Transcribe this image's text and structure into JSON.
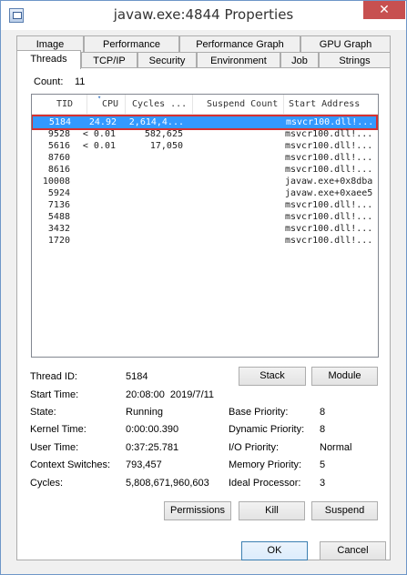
{
  "window": {
    "title": "javaw.exe:4844 Properties",
    "close_glyph": "✕"
  },
  "tabs_row1": [
    "Image",
    "Performance",
    "Performance Graph",
    "GPU Graph"
  ],
  "tabs_row2": [
    "Threads",
    "TCP/IP",
    "Security",
    "Environment",
    "Job",
    "Strings"
  ],
  "active_tab": "Threads",
  "count": {
    "label": "Count:",
    "value": "11"
  },
  "columns": [
    "TID",
    "CPU",
    "Cycles ...",
    "Suspend Count",
    "Start Address"
  ],
  "threads": [
    {
      "tid": "5184",
      "cpu": "24.92",
      "cycles": "2,614,4...",
      "address": "msvcr100.dll!...",
      "selected": true
    },
    {
      "tid": "9528",
      "cpu": "< 0.01",
      "cycles": "582,625",
      "address": "msvcr100.dll!..."
    },
    {
      "tid": "5616",
      "cpu": "< 0.01",
      "cycles": "17,050",
      "address": "msvcr100.dll!..."
    },
    {
      "tid": "8760",
      "cpu": "",
      "cycles": "",
      "address": "msvcr100.dll!..."
    },
    {
      "tid": "8616",
      "cpu": "",
      "cycles": "",
      "address": "msvcr100.dll!..."
    },
    {
      "tid": "10008",
      "cpu": "",
      "cycles": "",
      "address": "javaw.exe+0x8dba"
    },
    {
      "tid": "5924",
      "cpu": "",
      "cycles": "",
      "address": "javaw.exe+0xaee5"
    },
    {
      "tid": "7136",
      "cpu": "",
      "cycles": "",
      "address": "msvcr100.dll!..."
    },
    {
      "tid": "5488",
      "cpu": "",
      "cycles": "",
      "address": "msvcr100.dll!..."
    },
    {
      "tid": "3432",
      "cpu": "",
      "cycles": "",
      "address": "msvcr100.dll!..."
    },
    {
      "tid": "1720",
      "cpu": "",
      "cycles": "",
      "address": "msvcr100.dll!..."
    }
  ],
  "details": {
    "thread_id_label": "Thread ID:",
    "thread_id": "5184",
    "start_time_label": "Start Time:",
    "start_time": "20:08:00  2019/7/11",
    "state_label": "State:",
    "state": "Running",
    "kernel_time_label": "Kernel Time:",
    "kernel_time": "0:00:00.390",
    "user_time_label": "User Time:",
    "user_time": "0:37:25.781",
    "context_switches_label": "Context Switches:",
    "context_switches": "793,457",
    "cycles_label": "Cycles:",
    "cycles": "5,808,671,960,603",
    "base_priority_label": "Base Priority:",
    "base_priority": "8",
    "dynamic_priority_label": "Dynamic Priority:",
    "dynamic_priority": "8",
    "io_priority_label": "I/O Priority:",
    "io_priority": "Normal",
    "memory_priority_label": "Memory Priority:",
    "memory_priority": "5",
    "ideal_processor_label": "Ideal Processor:",
    "ideal_processor": "3"
  },
  "buttons": {
    "stack": "Stack",
    "module": "Module",
    "permissions": "Permissions",
    "kill": "Kill",
    "suspend": "Suspend",
    "ok": "OK",
    "cancel": "Cancel"
  },
  "colors": {
    "selection": "#3399ff",
    "selection_outline": "#d63030",
    "close_button": "#c75050"
  }
}
